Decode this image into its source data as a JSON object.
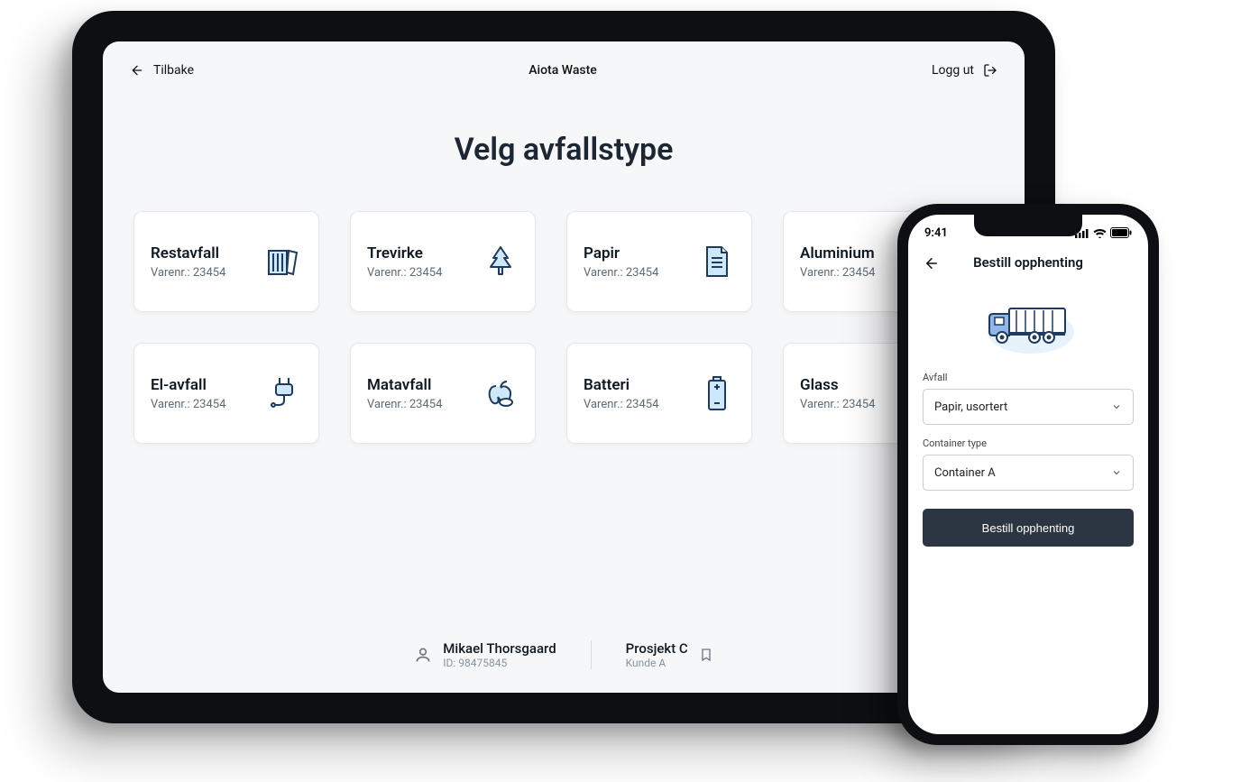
{
  "tablet": {
    "topbar": {
      "back_label": "Tilbake",
      "app_title": "Aiota Waste",
      "logout_label": "Logg ut"
    },
    "page_title": "Velg avfallstype",
    "cards": [
      {
        "title": "Restavfall",
        "sub": "Varenr.: 23454",
        "icon": "trash"
      },
      {
        "title": "Trevirke",
        "sub": "Varenr.: 23454",
        "icon": "tree"
      },
      {
        "title": "Papir",
        "sub": "Varenr.: 23454",
        "icon": "paper"
      },
      {
        "title": "Aluminium",
        "sub": "Varenr.: 23454",
        "icon": "aluminium"
      },
      {
        "title": "El-avfall",
        "sub": "Varenr.: 23454",
        "icon": "plug"
      },
      {
        "title": "Matavfall",
        "sub": "Varenr.: 23454",
        "icon": "apple"
      },
      {
        "title": "Batteri",
        "sub": "Varenr.: 23454",
        "icon": "battery"
      },
      {
        "title": "Glass",
        "sub": "Varenr.: 23454",
        "icon": "glass"
      }
    ],
    "footer": {
      "user_name": "Mikael Thorsgaard",
      "user_id": "ID: 98475845",
      "project_name": "Prosjekt C",
      "project_customer": "Kunde A"
    }
  },
  "phone": {
    "status_time": "9:41",
    "header_title": "Bestill opphenting",
    "form": {
      "waste_label": "Avfall",
      "waste_value": "Papir, usortert",
      "container_label": "Container type",
      "container_value": "Container A",
      "submit_label": "Bestill opphenting"
    }
  }
}
